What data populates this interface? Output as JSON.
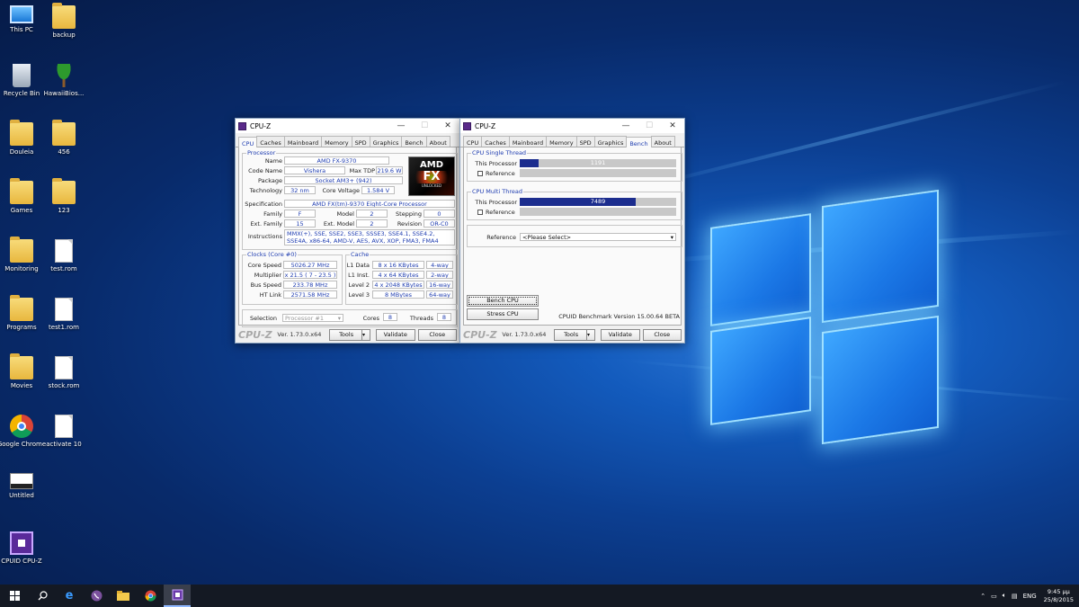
{
  "desktop": {
    "icons_left": [
      {
        "label": "This PC",
        "icon": "computer-icon"
      },
      {
        "label": "Recycle Bin",
        "icon": "recycle-bin-icon"
      },
      {
        "label": "Douleia",
        "icon": "folder-icon"
      },
      {
        "label": "Games",
        "icon": "folder-icon"
      },
      {
        "label": "Monitoring",
        "icon": "folder-icon"
      },
      {
        "label": "Programs",
        "icon": "folder-icon"
      },
      {
        "label": "Movies",
        "icon": "folder-icon"
      },
      {
        "label": "Google Chrome",
        "icon": "chrome-icon"
      },
      {
        "label": "Untitled",
        "icon": "app-icon"
      },
      {
        "label": "CPUID CPU-Z",
        "icon": "cpuz-icon"
      }
    ],
    "icons_right": [
      {
        "label": "backup",
        "icon": "folder-icon"
      },
      {
        "label": "HawaiiBios...",
        "icon": "palm-tree-icon"
      },
      {
        "label": "456",
        "icon": "folder-icon"
      },
      {
        "label": "123",
        "icon": "folder-icon"
      },
      {
        "label": "test.rom",
        "icon": "file-icon"
      },
      {
        "label": "test1.rom",
        "icon": "file-icon"
      },
      {
        "label": "stock.rom",
        "icon": "file-icon"
      },
      {
        "label": "activate 10",
        "icon": "text-file-icon"
      }
    ]
  },
  "win1": {
    "title": "CPU-Z",
    "tabs": [
      "CPU",
      "Caches",
      "Mainboard",
      "Memory",
      "SPD",
      "Graphics",
      "Bench",
      "About"
    ],
    "active_tab": "CPU",
    "processor": {
      "group": "Processor",
      "name_label": "Name",
      "name": "AMD FX-9370",
      "codename_label": "Code Name",
      "codename": "Vishera",
      "maxtdp_label": "Max TDP",
      "maxtdp": "219.6 W",
      "package_label": "Package",
      "package": "Socket AM3+ (942)",
      "technology_label": "Technology",
      "technology": "32 nm",
      "corevoltage_label": "Core Voltage",
      "corevoltage": "1.584 V",
      "spec_label": "Specification",
      "spec": "AMD FX(tm)-9370 Eight-Core Processor",
      "family_label": "Family",
      "family": "F",
      "model_label": "Model",
      "model": "2",
      "stepping_label": "Stepping",
      "stepping": "0",
      "extfamily_label": "Ext. Family",
      "extfamily": "15",
      "extmodel_label": "Ext. Model",
      "extmodel": "2",
      "revision_label": "Revision",
      "revision": "OR-C0",
      "instructions_label": "Instructions",
      "instructions": "MMX(+), SSE, SSE2, SSE3, SSSE3, SSE4.1, SSE4.2, SSE4A, x86-64, AMD-V, AES, AVX, XOP, FMA3, FMA4",
      "logo_brand": "AMD",
      "logo_model": "FX",
      "logo_sub": "UNLOCKED"
    },
    "clocks": {
      "group": "Clocks (Core #0)",
      "corespeed_label": "Core Speed",
      "corespeed": "5026.27 MHz",
      "multiplier_label": "Multiplier",
      "multiplier": "x 21.5 ( 7 - 23.5 )",
      "busspeed_label": "Bus Speed",
      "busspeed": "233.78 MHz",
      "htlink_label": "HT Link",
      "htlink": "2571.58 MHz"
    },
    "cache": {
      "group": "Cache",
      "l1data_label": "L1 Data",
      "l1data": "8 x 16 KBytes",
      "l1data_way": "4-way",
      "l1inst_label": "L1 Inst.",
      "l1inst": "4 x 64 KBytes",
      "l1inst_way": "2-way",
      "level2_label": "Level 2",
      "level2": "4 x 2048 KBytes",
      "level2_way": "16-way",
      "level3_label": "Level 3",
      "level3": "8 MBytes",
      "level3_way": "64-way"
    },
    "selection_label": "Selection",
    "selection": "Processor #1",
    "cores_label": "Cores",
    "cores": "8",
    "threads_label": "Threads",
    "threads": "8",
    "footer": {
      "logo": "CPU-Z",
      "version": "Ver. 1.73.0.x64",
      "tools": "Tools",
      "validate": "Validate",
      "close": "Close"
    }
  },
  "win2": {
    "title": "CPU-Z",
    "tabs": [
      "CPU",
      "Caches",
      "Mainboard",
      "Memory",
      "SPD",
      "Graphics",
      "Bench",
      "About"
    ],
    "active_tab": "Bench",
    "single": {
      "group": "CPU Single Thread",
      "this_label": "This Processor",
      "value": "1191",
      "fill_fraction": 0.12,
      "ref_label": "Reference"
    },
    "multi": {
      "group": "CPU Multi Thread",
      "this_label": "This Processor",
      "value": "7489",
      "fill_fraction": 0.74,
      "ref_label": "Reference"
    },
    "reference_label": "Reference",
    "reference_value": "<Please Select>",
    "bench_button": "Bench CPU",
    "stress_button": "Stress CPU",
    "bench_version": "CPUID Benchmark Version 15.00.64 BETA",
    "footer": {
      "logo": "CPU-Z",
      "version": "Ver. 1.73.0.x64",
      "tools": "Tools",
      "validate": "Validate",
      "close": "Close"
    }
  },
  "taskbar": {
    "tray_lang": "ENG",
    "time": "9:45 μμ",
    "date": "25/8/2015"
  },
  "colors": {
    "accent_blue": "#1f3db0",
    "bench_bar": "#1c2d8e"
  }
}
